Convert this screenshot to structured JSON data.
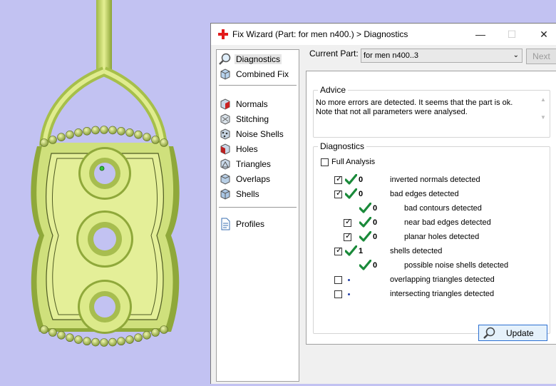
{
  "window": {
    "title": "Fix Wizard (Part: for men n400.) > Diagnostics",
    "icon": "red-cross-icon",
    "controls": [
      "minimize",
      "maximize",
      "close"
    ]
  },
  "sidebar": {
    "items": [
      {
        "label": "Diagnostics",
        "icon": "magnifier-icon",
        "selected": true
      },
      {
        "label": "Combined Fix",
        "icon": "cube-icon"
      },
      {
        "label": "Normals",
        "icon": "normals-icon"
      },
      {
        "label": "Stitching",
        "icon": "stitching-icon"
      },
      {
        "label": "Noise Shells",
        "icon": "noise-shells-icon"
      },
      {
        "label": "Holes",
        "icon": "holes-icon"
      },
      {
        "label": "Triangles",
        "icon": "triangles-icon"
      },
      {
        "label": "Overlaps",
        "icon": "overlaps-icon"
      },
      {
        "label": "Shells",
        "icon": "shells-icon"
      },
      {
        "label": "Profiles",
        "icon": "document-icon"
      }
    ]
  },
  "part": {
    "label": "Current Part:",
    "value": "for men n400..3",
    "next_label": "Next"
  },
  "advice": {
    "title": "Advice",
    "line1": "No more errors are detected. It seems that the part is ok.",
    "line2": "Note that not all parameters were analysed."
  },
  "diagnostics": {
    "title": "Diagnostics",
    "full_analysis_label": "Full Analysis",
    "full_analysis_checked": false,
    "rows": [
      {
        "label": "inverted normals detected",
        "count": "0",
        "checked": true,
        "status": "ok"
      },
      {
        "label": "bad edges detected",
        "count": "0",
        "checked": true,
        "status": "ok"
      },
      {
        "label": "bad contours detected",
        "count": "0",
        "status": "ok"
      },
      {
        "label": "near bad edges detected",
        "count": "0",
        "checked": true,
        "status": "ok"
      },
      {
        "label": "planar holes detected",
        "count": "0",
        "checked": true,
        "status": "ok"
      },
      {
        "label": "shells detected",
        "count": "1",
        "checked": true,
        "status": "ok"
      },
      {
        "label": "possible noise shells detected",
        "count": "0",
        "status": "ok"
      },
      {
        "label": "overlapping triangles detected",
        "count": "",
        "checked": false,
        "status": "not-run"
      },
      {
        "label": "intersecting triangles detected",
        "count": "",
        "checked": false,
        "status": "not-run"
      }
    ],
    "update_label": "Update"
  },
  "colors": {
    "viewport_bg": "#c2c2f2",
    "model_fill": "#dcea8a",
    "model_shade": "#8fa83a",
    "check_green": "#1a8a3a",
    "accent_blue": "#2b6fd1"
  }
}
